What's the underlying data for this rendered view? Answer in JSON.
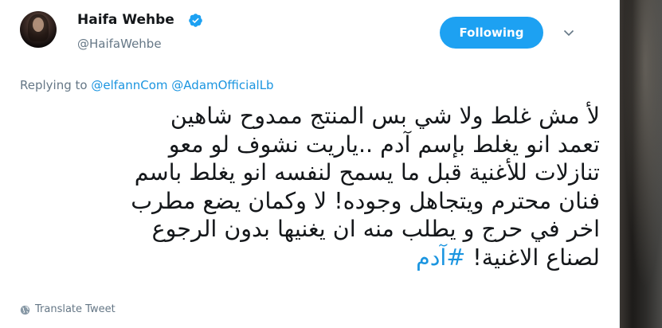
{
  "author": {
    "name": "Haifa Wehbe",
    "handle": "@HaifaWehbe",
    "verified": true
  },
  "follow_button": {
    "label": "Following"
  },
  "replying": {
    "prefix": "Replying to",
    "mentions": [
      "@elfannCom",
      "@AdamOfficialLb"
    ]
  },
  "tweet": {
    "lines": [
      "لأ مش غلط ولا شي بس المنتج ممدوح شاهين",
      "تعمد انو يغلط بإسم آدم ..ياريت نشوف لو معو",
      "تنازلات للأغنية قبل ما يسمح لنفسه انو يغلط باسم",
      "فنان محترم ويتجاهل وجوده! لا وكمان يضع مطرب",
      "اخر في حرج و يطلب منه ان يغنيها بدون الرجوع",
      "لصناع الاغنية!"
    ],
    "hashtag": "#آدم"
  },
  "translate": {
    "label": "Translate Tweet"
  },
  "colors": {
    "accent": "#1da1f2",
    "link": "#1b95e0",
    "text": "#14171a",
    "secondary": "#657786"
  },
  "icons": {
    "verified": "verified-badge-icon",
    "caret": "chevron-down-icon",
    "globe": "globe-icon"
  }
}
